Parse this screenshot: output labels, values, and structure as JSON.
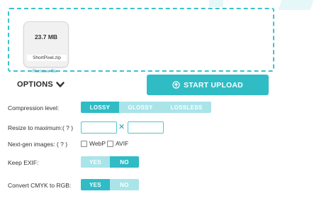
{
  "file": {
    "size": "23.7 MB",
    "name": "ShortPixel.zip",
    "remove_label": "Remove file"
  },
  "options": {
    "label": "OPTIONS",
    "icon": "chevron-down-icon"
  },
  "upload": {
    "label": "START UPLOAD",
    "icon": "upload-circle-icon"
  },
  "compression": {
    "label": "Compression level:",
    "options": [
      "LOSSY",
      "GLOSSY",
      "LOSSLESS"
    ],
    "selected": "LOSSY"
  },
  "resize": {
    "label": "Resize to maximum:( ? )",
    "separator": "✕",
    "width": "",
    "height": ""
  },
  "nextgen": {
    "label": "Next-gen images: ( ? )",
    "webp": "WebP",
    "avif": "AVIF"
  },
  "exif": {
    "label": "Keep EXIF:",
    "yes": "YES",
    "no": "NO",
    "selected": "NO"
  },
  "cmyk": {
    "label": "Convert CMYK to RGB:",
    "yes": "YES",
    "no": "NO",
    "selected": "YES"
  },
  "colors": {
    "accent": "#2fbcc5",
    "accent_light": "#a9e4e9",
    "link": "#2a9db3"
  }
}
